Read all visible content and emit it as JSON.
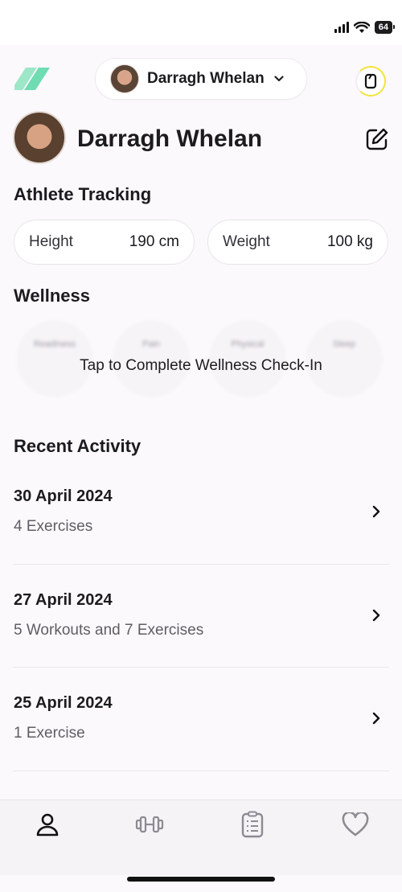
{
  "status_bar": {
    "battery": "64"
  },
  "header": {
    "profile_name": "Darragh Whelan"
  },
  "athlete": {
    "name": "Darragh Whelan"
  },
  "tracking": {
    "title": "Athlete Tracking",
    "height_label": "Height",
    "height_value": "190 cm",
    "weight_label": "Weight",
    "weight_value": "100 kg"
  },
  "wellness": {
    "title": "Wellness",
    "categories": [
      "Readiness",
      "Pain",
      "Physical",
      "Sleep"
    ],
    "cta": "Tap to Complete Wellness Check-In"
  },
  "activity": {
    "title": "Recent Activity",
    "items": [
      {
        "date": "30 April 2024",
        "summary": "4 Exercises"
      },
      {
        "date": "27 April 2024",
        "summary": "5 Workouts and 7 Exercises"
      },
      {
        "date": "25 April 2024",
        "summary": "1 Exercise"
      }
    ]
  },
  "tabs": [
    "profile-icon",
    "dumbbell-icon",
    "clipboard-icon",
    "heart-icon"
  ],
  "colors": {
    "accent_green": "#7ee0b7",
    "sync_ring": "#f3e33a",
    "background": "#fcf9fc"
  }
}
